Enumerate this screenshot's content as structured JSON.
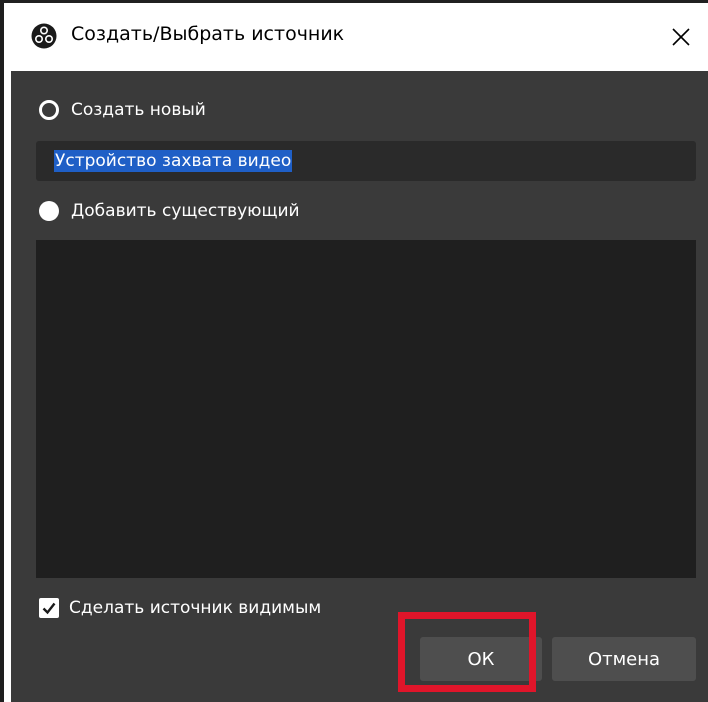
{
  "window": {
    "title": "Создать/Выбрать источник",
    "icon": "obs-logo-icon",
    "close_glyph": "✕"
  },
  "create_new": {
    "label": "Создать новый",
    "selected": true
  },
  "name_field": {
    "value": "Устройство захвата видео"
  },
  "add_existing": {
    "label": "Добавить существующий",
    "selected": false
  },
  "visible_checkbox": {
    "label": "Сделать источник видимым",
    "checked": true
  },
  "buttons": {
    "ok_label": "ОК",
    "cancel_label": "Отмена"
  },
  "colors": {
    "content_bg": "#3a3a3a",
    "list_bg": "#1f1f1f",
    "selection": "#1f5fc6",
    "highlight": "#e0152a"
  }
}
